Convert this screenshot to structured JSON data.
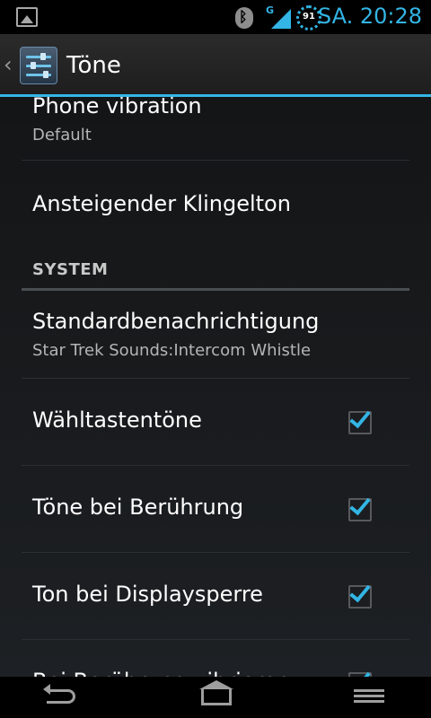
{
  "status_bar": {
    "time": "SA. 20:28",
    "battery_level": "91",
    "network_type": "G",
    "icons": [
      "gallery-notification-icon",
      "bluetooth-icon",
      "signal-icon",
      "battery-icon"
    ]
  },
  "action_bar": {
    "back_glyph": "‹",
    "app_icon": "sliders-settings-icon",
    "title": "Töne"
  },
  "list": {
    "items": [
      {
        "title": "Phone vibration",
        "subtitle": "Default"
      },
      {
        "title": "Ansteigender Klingelton"
      }
    ],
    "section_header": "SYSTEM",
    "system_items": [
      {
        "title": "Standardbenachrichtigung",
        "subtitle": "Star Trek Sounds:Intercom Whistle"
      },
      {
        "title": "Wähltastentöne",
        "checked": true
      },
      {
        "title": "Töne bei Berührung",
        "checked": true
      },
      {
        "title": "Ton bei Displaysperre",
        "checked": true
      },
      {
        "title": "Bei Berührung vibrieren",
        "checked": true
      }
    ]
  },
  "navbar": {
    "icons": [
      "back-icon",
      "home-icon",
      "recent-apps-icon"
    ]
  },
  "colors": {
    "accent": "#33b5e5",
    "background": "#000000",
    "text_primary": "#ffffff",
    "text_secondary": "#b5b5b5"
  }
}
